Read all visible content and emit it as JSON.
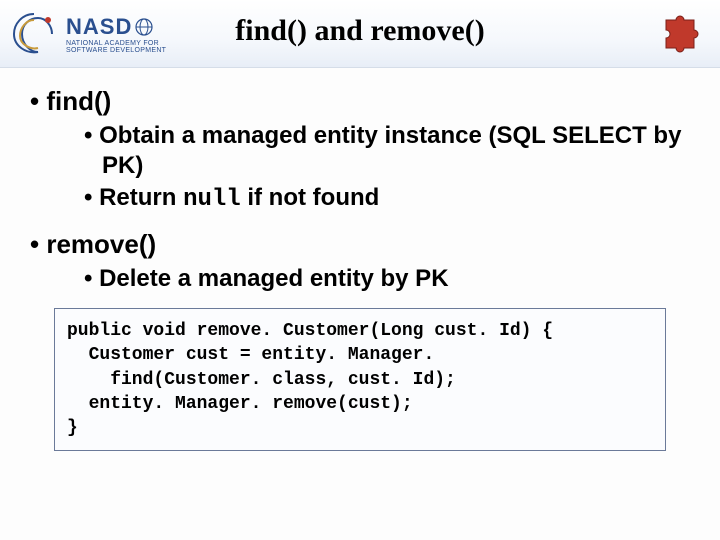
{
  "header": {
    "logo_main": "NASD",
    "logo_sub_line1": "NATIONAL ACADEMY FOR",
    "logo_sub_line2": "SOFTWARE DEVELOPMENT"
  },
  "title": "find() and remove()",
  "bullets": {
    "b1": "find()",
    "b1_1": "Obtain a managed entity instance (SQL SELECT by PK)",
    "b1_2a": "Return ",
    "b1_2_code": "null",
    "b1_2b": " if not found",
    "b2": "remove()",
    "b2_1": "Delete a managed entity by PK"
  },
  "code": "public void remove. Customer(Long cust. Id) {\n  Customer cust = entity. Manager.\n    find(Customer. class, cust. Id);\n  entity. Manager. remove(cust);\n}"
}
